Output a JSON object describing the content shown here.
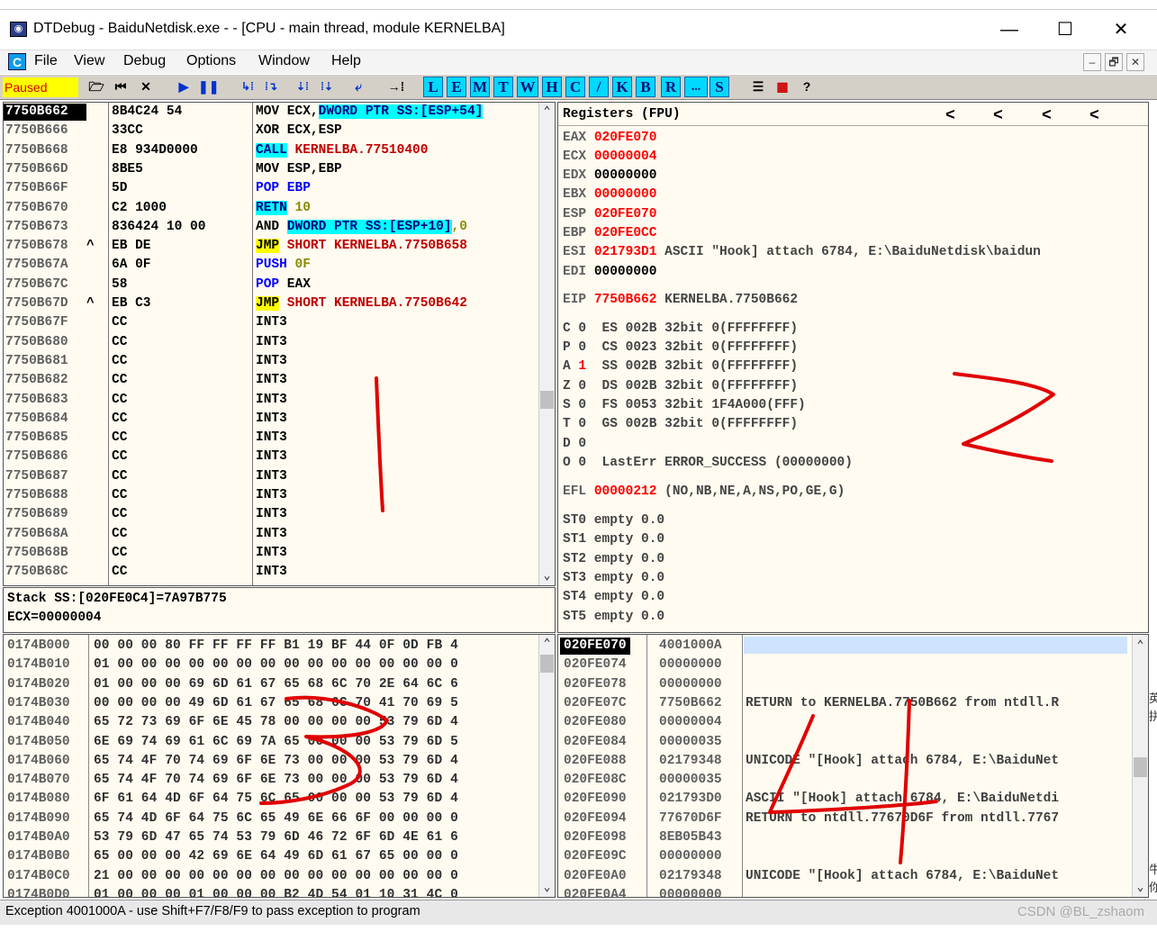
{
  "window": {
    "title": "DTDebug - BaiduNetdisk.exe - - [CPU - main thread, module KERNELBA]",
    "app_icon": "debugger-app-icon",
    "controls": [
      "—",
      "☐",
      "✕"
    ]
  },
  "menubar": {
    "mdi_icon_label": "C",
    "items": [
      "File",
      "View",
      "Debug",
      "Options",
      "Window",
      "Help"
    ],
    "mdi_controls": [
      "–",
      "🗗",
      "✕"
    ]
  },
  "toolbar": {
    "status": "Paused",
    "letter_buttons": [
      "L",
      "E",
      "M",
      "T",
      "W",
      "H",
      "C",
      "/",
      "K",
      "B",
      "R",
      "...",
      "S"
    ],
    "icons": [
      "open-icon",
      "rewind-icon",
      "close-icon",
      "run-icon",
      "pause-icon",
      "step-into-icon",
      "step-over-icon",
      "trace-into-icon",
      "trace-over-icon",
      "execute-till-return-icon",
      "goto-icon",
      "list-icon",
      "grid-icon",
      "help-icon"
    ]
  },
  "cpu": {
    "rows": [
      {
        "addr": "7750B662",
        "jmp": "",
        "hex": "8B4C24 54",
        "asm": [
          [
            "MOV ECX,",
            ""
          ],
          [
            "DWORD PTR SS:[ESP+54]",
            "hl-cyan t-navy"
          ]
        ],
        "selected": true
      },
      {
        "addr": "7750B666",
        "jmp": "",
        "hex": "33CC",
        "asm": [
          [
            "XOR ECX,ESP",
            ""
          ]
        ]
      },
      {
        "addr": "7750B668",
        "jmp": "",
        "hex": "E8 934D0000",
        "asm": [
          [
            "CALL",
            "hl-cyan t-navy"
          ],
          [
            " KERNELBA.77510400",
            "t-red"
          ]
        ]
      },
      {
        "addr": "7750B66D",
        "jmp": "",
        "hex": "8BE5",
        "asm": [
          [
            "MOV ESP,EBP",
            ""
          ]
        ]
      },
      {
        "addr": "7750B66F",
        "jmp": "",
        "hex": "5D",
        "asm": [
          [
            "POP EBP",
            "t-blue"
          ]
        ]
      },
      {
        "addr": "7750B670",
        "jmp": "",
        "hex": "C2 1000",
        "asm": [
          [
            "RETN",
            "hl-cyan t-navy"
          ],
          [
            " 10",
            "t-olive"
          ]
        ]
      },
      {
        "addr": "7750B673",
        "jmp": "",
        "hex": "836424 10 00",
        "asm": [
          [
            "AND ",
            ""
          ],
          [
            "DWORD PTR SS:[ESP+10]",
            "hl-cyan t-navy"
          ],
          [
            ",0",
            "t-olive"
          ]
        ]
      },
      {
        "addr": "7750B678",
        "jmp": "^",
        "hex": "EB DE",
        "asm": [
          [
            "JMP",
            "hl-yellow"
          ],
          [
            " SHORT KERNELBA.7750B658",
            "t-red"
          ]
        ]
      },
      {
        "addr": "7750B67A",
        "jmp": "",
        "hex": "6A 0F",
        "asm": [
          [
            "PUSH",
            "t-blue"
          ],
          [
            " 0F",
            "t-olive"
          ]
        ]
      },
      {
        "addr": "7750B67C",
        "jmp": "",
        "hex": "58",
        "asm": [
          [
            "POP",
            "t-blue"
          ],
          [
            " EAX",
            ""
          ]
        ]
      },
      {
        "addr": "7750B67D",
        "jmp": "^",
        "hex": "EB C3",
        "asm": [
          [
            "JMP",
            "hl-yellow"
          ],
          [
            " SHORT KERNELBA.7750B642",
            "t-red"
          ]
        ]
      },
      {
        "addr": "7750B67F",
        "jmp": "",
        "hex": "CC",
        "asm": [
          [
            "INT3",
            ""
          ]
        ]
      },
      {
        "addr": "7750B680",
        "jmp": "",
        "hex": "CC",
        "asm": [
          [
            "INT3",
            ""
          ]
        ]
      },
      {
        "addr": "7750B681",
        "jmp": "",
        "hex": "CC",
        "asm": [
          [
            "INT3",
            ""
          ]
        ]
      },
      {
        "addr": "7750B682",
        "jmp": "",
        "hex": "CC",
        "asm": [
          [
            "INT3",
            ""
          ]
        ]
      },
      {
        "addr": "7750B683",
        "jmp": "",
        "hex": "CC",
        "asm": [
          [
            "INT3",
            ""
          ]
        ]
      },
      {
        "addr": "7750B684",
        "jmp": "",
        "hex": "CC",
        "asm": [
          [
            "INT3",
            ""
          ]
        ]
      },
      {
        "addr": "7750B685",
        "jmp": "",
        "hex": "CC",
        "asm": [
          [
            "INT3",
            ""
          ]
        ]
      },
      {
        "addr": "7750B686",
        "jmp": "",
        "hex": "CC",
        "asm": [
          [
            "INT3",
            ""
          ]
        ]
      },
      {
        "addr": "7750B687",
        "jmp": "",
        "hex": "CC",
        "asm": [
          [
            "INT3",
            ""
          ]
        ]
      },
      {
        "addr": "7750B688",
        "jmp": "",
        "hex": "CC",
        "asm": [
          [
            "INT3",
            ""
          ]
        ]
      },
      {
        "addr": "7750B689",
        "jmp": "",
        "hex": "CC",
        "asm": [
          [
            "INT3",
            ""
          ]
        ]
      },
      {
        "addr": "7750B68A",
        "jmp": "",
        "hex": "CC",
        "asm": [
          [
            "INT3",
            ""
          ]
        ]
      },
      {
        "addr": "7750B68B",
        "jmp": "",
        "hex": "CC",
        "asm": [
          [
            "INT3",
            ""
          ]
        ]
      },
      {
        "addr": "7750B68C",
        "jmp": "",
        "hex": "CC",
        "asm": [
          [
            "INT3",
            ""
          ]
        ]
      }
    ]
  },
  "info": {
    "line1": "Stack SS:[020FE0C4]=7A97B775",
    "line2": "ECX=00000004"
  },
  "registers": {
    "title": "Registers (FPU)",
    "nav": [
      "<",
      "<",
      "<",
      "<"
    ],
    "lines": [
      [
        [
          "EAX ",
          "r-name"
        ],
        [
          "020FE070",
          "r-val"
        ]
      ],
      [
        [
          "ECX ",
          "r-name"
        ],
        [
          "00000004",
          "r-val"
        ]
      ],
      [
        [
          "EDX ",
          "r-name"
        ],
        [
          "00000000",
          "r-norm"
        ]
      ],
      [
        [
          "EBX ",
          "r-name"
        ],
        [
          "00000000",
          "r-val"
        ]
      ],
      [
        [
          "ESP ",
          "r-name"
        ],
        [
          "020FE070",
          "r-val"
        ]
      ],
      [
        [
          "EBP ",
          "r-name"
        ],
        [
          "020FE0CC",
          "r-val"
        ]
      ],
      [
        [
          "ESI ",
          "r-name"
        ],
        [
          "021793D1",
          "r-val"
        ],
        [
          " ASCII \"Hook] attach 6784, E:\\BaiduNetdisk\\baidun",
          "r-comment"
        ]
      ],
      [
        [
          "EDI ",
          "r-name"
        ],
        [
          "00000000",
          "r-norm"
        ]
      ],
      [
        [
          "EIP ",
          "r-name"
        ],
        [
          "7750B662",
          "r-val"
        ],
        [
          " KERNELBA.7750B662",
          "r-comment"
        ]
      ],
      [
        [
          "C 0  ES 002B 32bit 0(FFFFFFFF)",
          "r-comment"
        ]
      ],
      [
        [
          "P 0  CS 0023 32bit 0(FFFFFFFF)",
          "r-comment"
        ]
      ],
      [
        [
          "A ",
          "r-comment"
        ],
        [
          "1",
          "r-val"
        ],
        [
          "  SS 002B 32bit 0(FFFFFFFF)",
          "r-comment"
        ]
      ],
      [
        [
          "Z 0  DS 002B 32bit 0(FFFFFFFF)",
          "r-comment"
        ]
      ],
      [
        [
          "S 0  FS 0053 32bit 1F4A000(FFF)",
          "r-comment"
        ]
      ],
      [
        [
          "T 0  GS 002B 32bit 0(FFFFFFFF)",
          "r-comment"
        ]
      ],
      [
        [
          "D 0",
          "r-comment"
        ]
      ],
      [
        [
          "O 0  LastErr ERROR_SUCCESS (00000000)",
          "r-comment"
        ]
      ],
      [
        [
          "EFL ",
          "r-name"
        ],
        [
          "00000212",
          "r-val"
        ],
        [
          " (NO,NB,NE,A,NS,PO,GE,G)",
          "r-comment"
        ]
      ],
      [
        [
          "ST0 empty 0.0",
          "r-comment"
        ]
      ],
      [
        [
          "ST1 empty 0.0",
          "r-comment"
        ]
      ],
      [
        [
          "ST2 empty 0.0",
          "r-comment"
        ]
      ],
      [
        [
          "ST3 empty 0.0",
          "r-comment"
        ]
      ],
      [
        [
          "ST4 empty 0.0",
          "r-comment"
        ]
      ],
      [
        [
          "ST5 empty 0.0",
          "r-comment"
        ]
      ]
    ]
  },
  "dump": {
    "rows": [
      [
        "0174B000",
        "00 00 00 80 FF FF FF FF B1 19 BF 44 0F 0D FB 4"
      ],
      [
        "0174B010",
        "01 00 00 00 00 00 00 00 00 00 00 00 00 00 00 0"
      ],
      [
        "0174B020",
        "01 00 00 00 69 6D 61 67 65 68 6C 70 2E 64 6C 6"
      ],
      [
        "0174B030",
        "00 00 00 00 49 6D 61 67 65 68 6C 70 41 70 69 5"
      ],
      [
        "0174B040",
        "65 72 73 69 6F 6E 45 78 00 00 00 00 53 79 6D 4"
      ],
      [
        "0174B050",
        "6E 69 74 69 61 6C 69 7A 65 00 00 00 53 79 6D 5"
      ],
      [
        "0174B060",
        "65 74 4F 70 74 69 6F 6E 73 00 00 00 53 79 6D 4"
      ],
      [
        "0174B070",
        "65 74 4F 70 74 69 6F 6E 73 00 00 00 53 79 6D 4"
      ],
      [
        "0174B080",
        "6F 61 64 4D 6F 64 75 6C 65 00 00 00 53 79 6D 4"
      ],
      [
        "0174B090",
        "65 74 4D 6F 64 75 6C 65 49 6E 66 6F 00 00 00 0"
      ],
      [
        "0174B0A0",
        "53 79 6D 47 65 74 53 79 6D 46 72 6F 6D 4E 61 6"
      ],
      [
        "0174B0B0",
        "65 00 00 00 42 69 6E 64 49 6D 61 67 65 00 00 0"
      ],
      [
        "0174B0C0",
        "21 00 00 00 00 00 00 00 00 00 00 00 00 00 00 0"
      ],
      [
        "0174B0D0",
        "01 00 00 00 01 00 00 00 B2 4D 54 01 10 31 4C 0"
      ]
    ]
  },
  "stack": {
    "rows": [
      [
        "020FE070",
        "4001000A",
        ""
      ],
      [
        "020FE074",
        "00000000",
        ""
      ],
      [
        "020FE078",
        "00000000",
        ""
      ],
      [
        "020FE07C",
        "7750B662",
        "RETURN to KERNELBA.7750B662 from ntdll.R"
      ],
      [
        "020FE080",
        "00000004",
        ""
      ],
      [
        "020FE084",
        "00000035",
        ""
      ],
      [
        "020FE088",
        "02179348",
        "UNICODE \"[Hook] attach 6784, E:\\BaiduNet"
      ],
      [
        "020FE08C",
        "00000035",
        ""
      ],
      [
        "020FE090",
        "021793D0",
        "ASCII \"[Hook] attach 6784, E:\\BaiduNetdi"
      ],
      [
        "020FE094",
        "77670D6F",
        "RETURN to ntdll.77670D6F from ntdll.7767"
      ],
      [
        "020FE098",
        "8EB05B43",
        ""
      ],
      [
        "020FE09C",
        "00000000",
        ""
      ],
      [
        "020FE0A0",
        "02179348",
        "UNICODE \"[Hook] attach 6784, E:\\BaiduNet"
      ],
      [
        "020FE0A4",
        "00000000",
        ""
      ]
    ]
  },
  "statusbar": {
    "text": "Exception 4001000A - use Shift+F7/F8/F9 to pass exception to program",
    "watermark": "CSDN @BL_zshaom"
  },
  "edge_chars": [
    "英",
    "拼",
    "牛",
    "你"
  ]
}
